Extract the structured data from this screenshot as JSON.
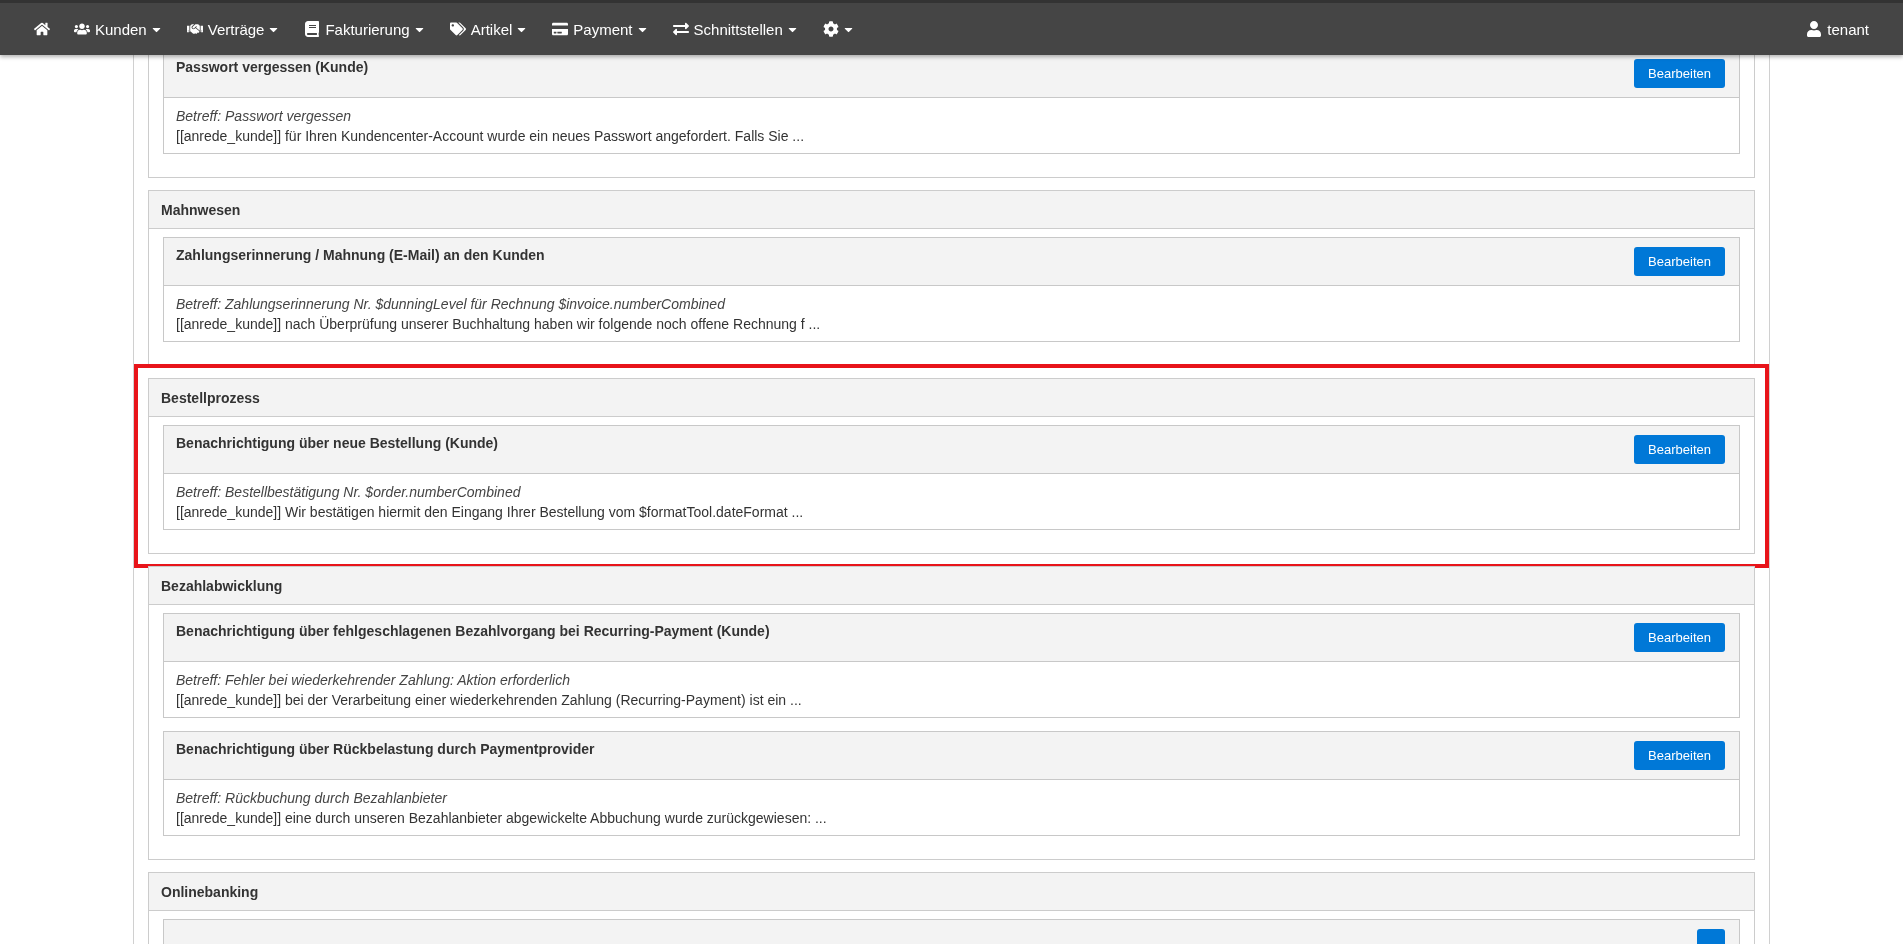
{
  "navbar": {
    "items": [
      {
        "kind": "home"
      },
      {
        "kind": "menu",
        "label": "Kunden"
      },
      {
        "kind": "menu",
        "label": "Verträge"
      },
      {
        "kind": "menu",
        "label": "Fakturierung"
      },
      {
        "kind": "menu",
        "label": "Artikel"
      },
      {
        "kind": "menu",
        "label": "Payment"
      },
      {
        "kind": "menu",
        "label": "Schnittstellen"
      },
      {
        "kind": "icon-menu"
      }
    ],
    "user": {
      "label": "tenant"
    }
  },
  "sections": [
    {
      "highlighted": false,
      "items": [
        {
          "title": "Passwort vergessen (Kunde)",
          "button": "Bearbeiten",
          "subject": "Betreff: Passwort vergessen",
          "preview": "[[anrede_kunde]] für Ihren Kundencenter-Account wurde ein neues Passwort angefordert. Falls Sie ..."
        }
      ]
    },
    {
      "title": "Mahnwesen",
      "highlighted": false,
      "items": [
        {
          "title": "Zahlungserinnerung / Mahnung (E-Mail) an den Kunden",
          "button": "Bearbeiten",
          "subject": "Betreff: Zahlungserinnerung Nr. $dunningLevel für Rechnung $invoice.numberCombined",
          "preview": "[[anrede_kunde]] nach Überprüfung unserer Buchhaltung haben wir folgende noch offene Rechnung f ..."
        }
      ]
    },
    {
      "title": "Bestellprozess",
      "highlighted": true,
      "items": [
        {
          "title": "Benachrichtigung über neue Bestellung (Kunde)",
          "button": "Bearbeiten",
          "subject": "Betreff: Bestellbestätigung Nr. $order.numberCombined",
          "preview": "[[anrede_kunde]] Wir bestätigen hiermit den Eingang Ihrer Bestellung vom $formatTool.dateFormat ..."
        }
      ]
    },
    {
      "title": "Bezahlabwicklung",
      "highlighted": false,
      "items": [
        {
          "title": "Benachrichtigung über fehlgeschlagenen Bezahlvorgang bei Recurring-Payment (Kunde)",
          "button": "Bearbeiten",
          "subject": "Betreff: Fehler bei wiederkehrender Zahlung: Aktion erforderlich",
          "preview": "[[anrede_kunde]] bei der Verarbeitung einer wiederkehrenden Zahlung (Recurring-Payment) ist ein ..."
        },
        {
          "title": "Benachrichtigung über Rückbelastung durch Paymentprovider",
          "button": "Bearbeiten",
          "subject": "Betreff: Rückbuchung durch Bezahlanbieter",
          "preview": "[[anrede_kunde]] eine durch unseren Bezahlanbieter abgewickelte Abbuchung wurde zurückgewiesen: ..."
        }
      ]
    },
    {
      "title": "Onlinebanking",
      "highlighted": false,
      "items": [
        {
          "partial": true
        }
      ]
    }
  ]
}
